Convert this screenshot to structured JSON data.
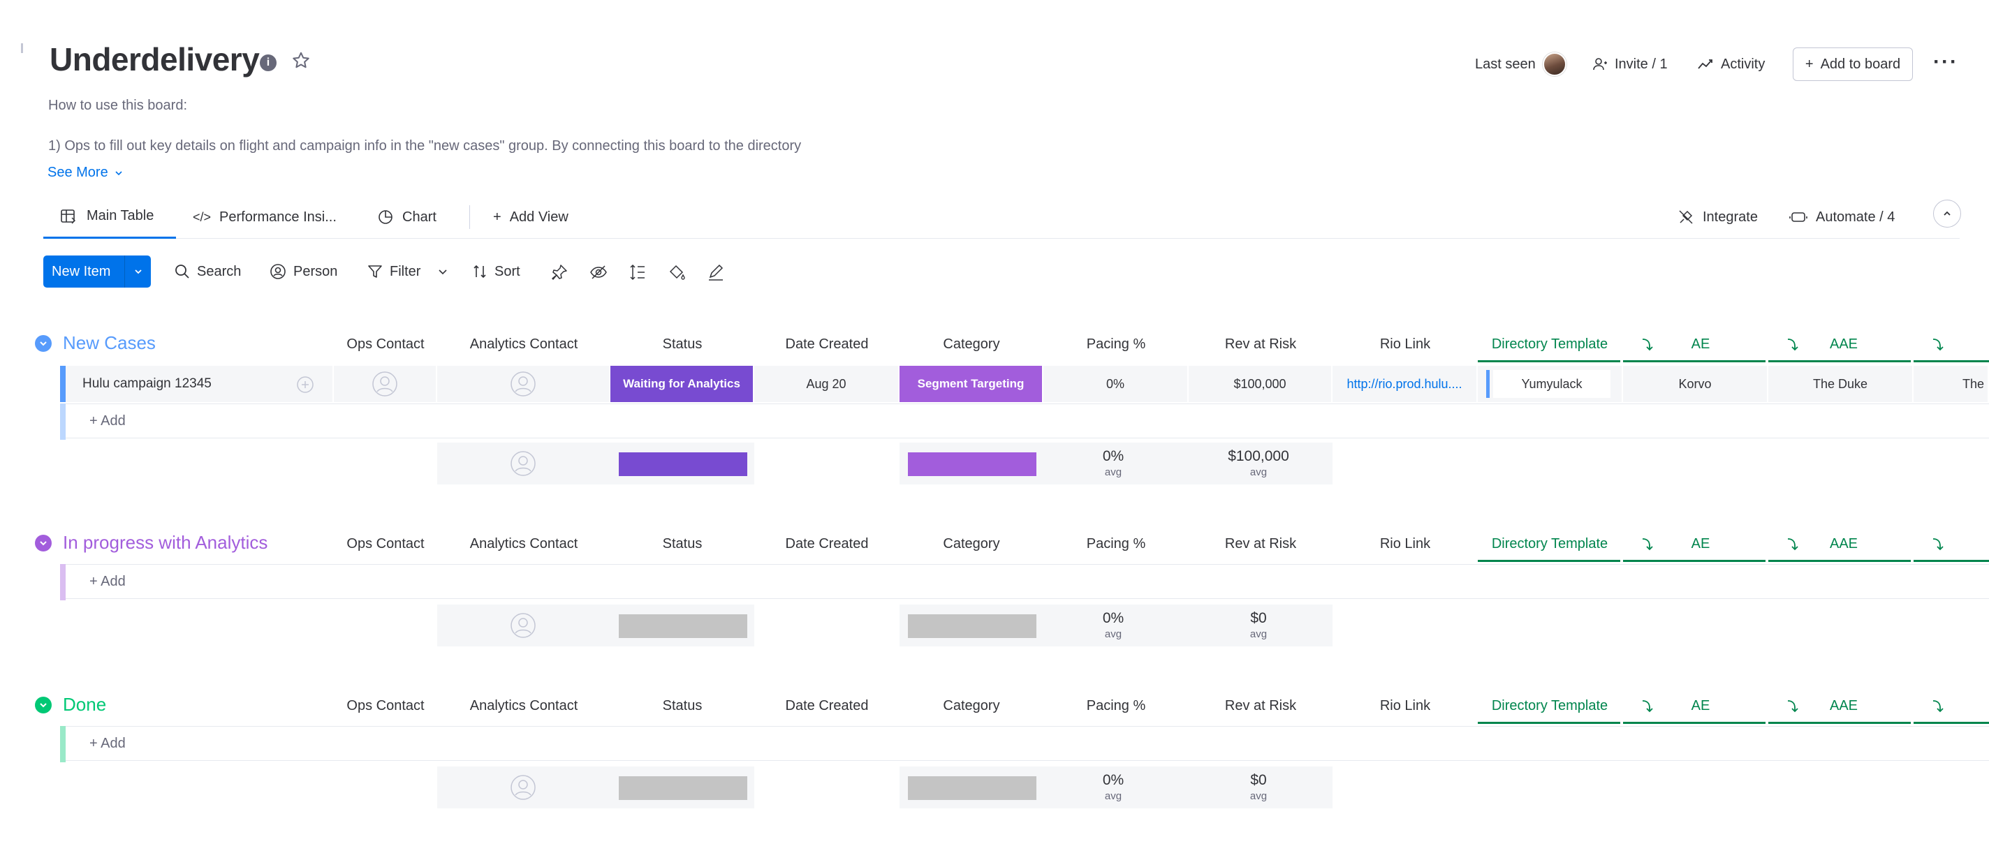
{
  "board": {
    "title": "Underdelivery",
    "description_heading": "How to use this board:",
    "description_line": "1) Ops to fill out key details on flight and campaign info in the \"new cases\" group. By connecting this board to the directory",
    "see_more": "See More"
  },
  "header_actions": {
    "last_seen": "Last seen",
    "invite": "Invite / 1",
    "activity": "Activity",
    "add_to_board": "Add to board"
  },
  "views": {
    "main_table": "Main Table",
    "performance": "Performance Insi...",
    "chart": "Chart",
    "add_view": "Add View",
    "integrate": "Integrate",
    "automate": "Automate / 4"
  },
  "toolbar": {
    "new_item": "New Item",
    "search": "Search",
    "person": "Person",
    "filter": "Filter",
    "sort": "Sort"
  },
  "columns": {
    "ops_contact": "Ops Contact",
    "analytics_contact": "Analytics Contact",
    "status": "Status",
    "date_created": "Date Created",
    "category": "Category",
    "pacing": "Pacing %",
    "rev_at_risk": "Rev at Risk",
    "rio_link": "Rio Link",
    "directory_template": "Directory Template",
    "ae": "AE",
    "aae": "AAE"
  },
  "groups": [
    {
      "title": "New Cases",
      "color": "#579bfc",
      "add_label": "+ Add",
      "item": {
        "name": "Hulu campaign 12345",
        "status": "Waiting for Analytics",
        "status_color": "#784bd1",
        "date": "Aug 20",
        "category": "Segment Targeting",
        "category_color": "#a25ddc",
        "pacing": "0%",
        "rev": "$100,000",
        "rio_link": "http://rio.prod.hulu....",
        "directory_template": "Yumyulack",
        "ae": "Korvo",
        "aae": "The Duke",
        "extra": "The"
      },
      "summary": {
        "pacing": "0%",
        "pacing_sub": "avg",
        "rev": "$100,000",
        "rev_sub": "avg"
      }
    },
    {
      "title": "In progress with Analytics",
      "color": "#a25ddc",
      "add_label": "+ Add",
      "summary": {
        "pacing": "0%",
        "pacing_sub": "avg",
        "rev": "$0",
        "rev_sub": "avg"
      }
    },
    {
      "title": "Done",
      "color": "#00c875",
      "add_label": "+ Add",
      "summary": {
        "pacing": "0%",
        "pacing_sub": "avg",
        "rev": "$0",
        "rev_sub": "avg"
      }
    }
  ]
}
